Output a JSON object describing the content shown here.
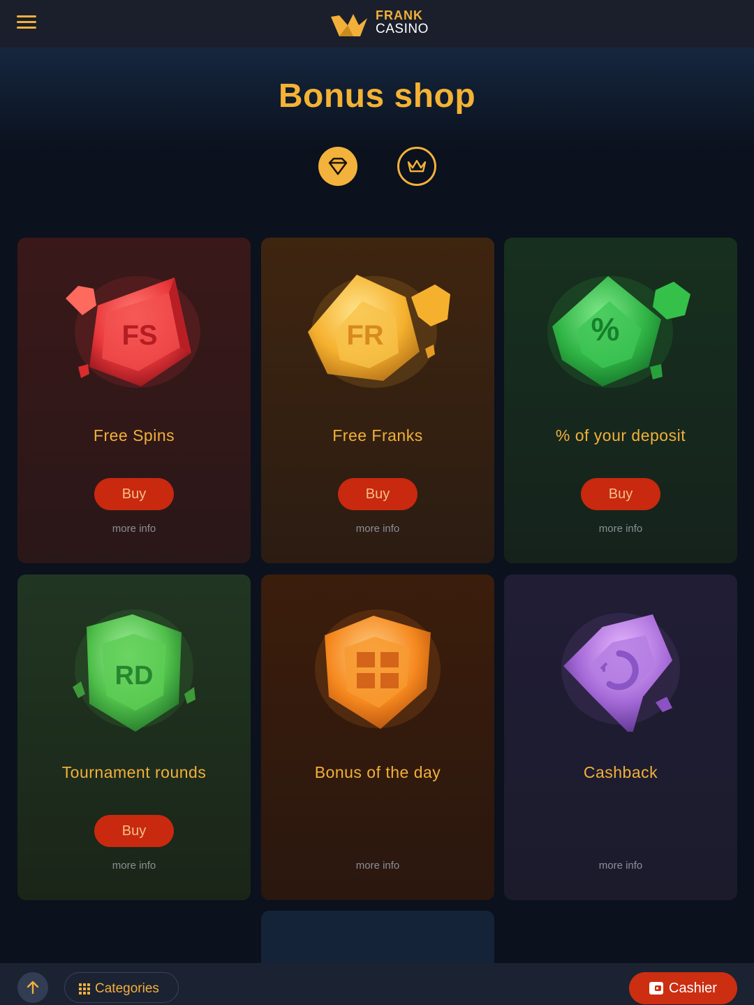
{
  "header": {
    "menu_icon": "hamburger-menu-icon",
    "logo": {
      "line1": "FRANK",
      "line2": "CASINO",
      "icon": "crown-icon"
    }
  },
  "page": {
    "title": "Bonus shop"
  },
  "tabs": [
    {
      "icon": "diamond-icon",
      "active": true
    },
    {
      "icon": "crown-icon",
      "active": false
    }
  ],
  "cards": [
    {
      "title": "Free Spins",
      "gem_label": "FS",
      "gem_color": "#e8373a",
      "buy_label": "Buy",
      "more_info": "more info"
    },
    {
      "title": "Free Franks",
      "gem_label": "FR",
      "gem_color": "#f5b12e",
      "buy_label": "Buy",
      "more_info": "more info"
    },
    {
      "title": "% of your deposit",
      "gem_label": "%",
      "gem_color": "#2fb344",
      "buy_label": "Buy",
      "more_info": "more info"
    },
    {
      "title": "Tournament rounds",
      "gem_label": "RD",
      "gem_color": "#4fbf4a",
      "buy_label": "Buy",
      "more_info": "more info"
    },
    {
      "title": "Bonus of the day",
      "gem_icon": "gift-icon",
      "gem_color": "#f5881e",
      "more_info": "more info"
    },
    {
      "title": "Cashback",
      "gem_icon": "cashback-icon",
      "gem_color": "#a66ad8",
      "more_info": "more info"
    }
  ],
  "bottom_bar": {
    "scroll_icon": "arrow-up-icon",
    "categories_label": "Categories",
    "cashier_label": "Cashier"
  },
  "colors": {
    "accent": "#f2b03a",
    "buy_button": "#c8290f",
    "cashier_button": "#cc2e12",
    "background": "#0b111d"
  }
}
